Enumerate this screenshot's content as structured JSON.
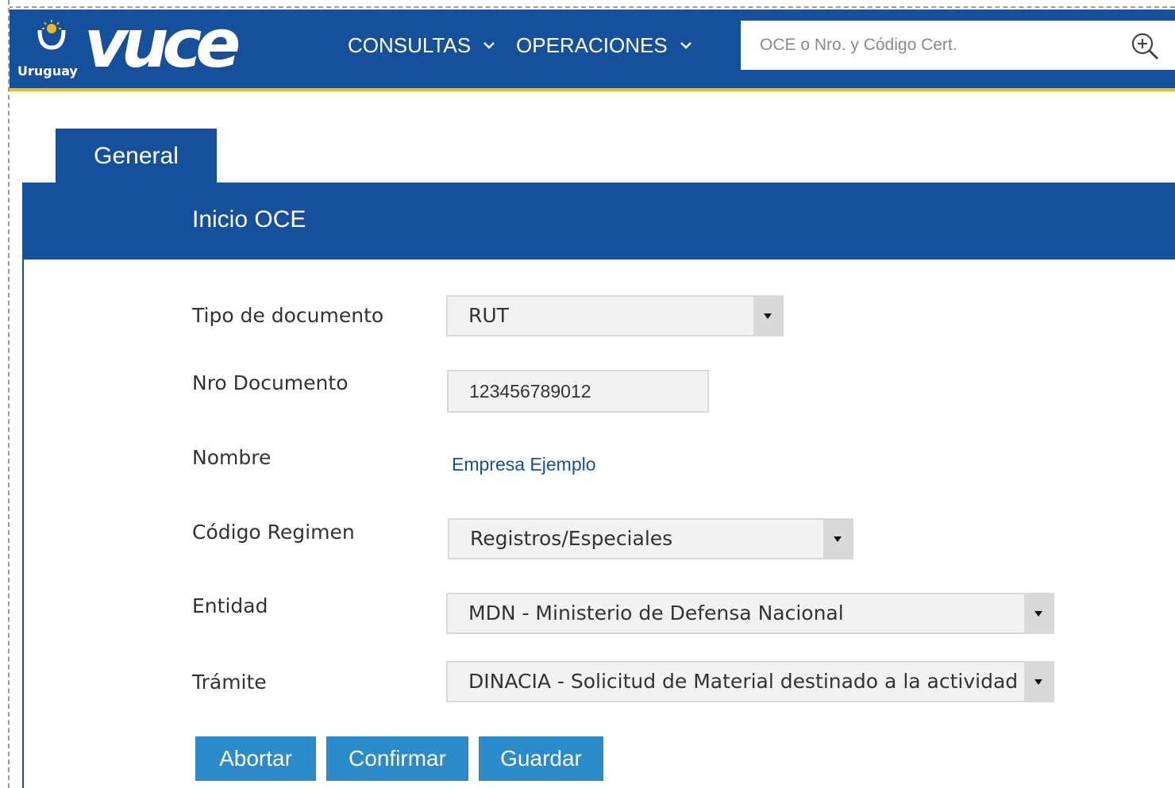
{
  "header": {
    "country": "Uruguay",
    "brand": "vuce",
    "nav": [
      {
        "label": "CONSULTAS"
      },
      {
        "label": "OPERACIONES"
      }
    ],
    "search_placeholder": "OCE o Nro. y Código Cert.",
    "colors": {
      "primary": "#16509a",
      "accent": "#f4b724"
    }
  },
  "tabs": [
    {
      "label": "General"
    }
  ],
  "section_title": "Inicio OCE",
  "form": {
    "tipo_documento": {
      "label": "Tipo de documento",
      "value": "RUT"
    },
    "nro_documento": {
      "label": "Nro Documento",
      "value": "123456789012"
    },
    "nombre": {
      "label": "Nombre",
      "value": "Empresa Ejemplo"
    },
    "codigo_regimen": {
      "label": "Código Regimen",
      "value": "Registros/Especiales"
    },
    "entidad": {
      "label": "Entidad",
      "value": "MDN - Ministerio de Defensa Nacional"
    },
    "tramite": {
      "label": "Trámite",
      "value": "DINACIA - Solicitud de Material destinado a la actividad aero"
    }
  },
  "buttons": {
    "abortar": "Abortar",
    "confirmar": "Confirmar",
    "guardar": "Guardar",
    "color": "#2b8ac8"
  }
}
